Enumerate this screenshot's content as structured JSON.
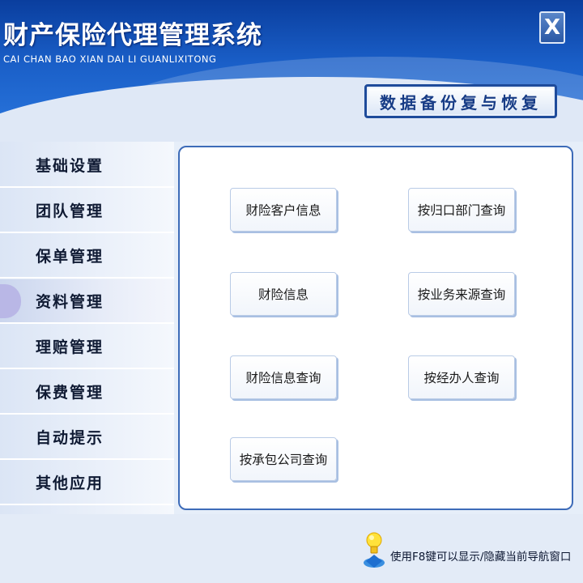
{
  "header": {
    "title": "财产保险代理管理系统",
    "subtitle": "CAI CHAN BAO XIAN DAI LI GUANLIXITONG",
    "close_label": "X",
    "backup_label": "数据备份复与恢复"
  },
  "sidebar": {
    "items": [
      {
        "label": "基础设置"
      },
      {
        "label": "团队管理"
      },
      {
        "label": "保单管理"
      },
      {
        "label": "资料管理",
        "active": true
      },
      {
        "label": "理赔管理"
      },
      {
        "label": "保费管理"
      },
      {
        "label": "自动提示"
      },
      {
        "label": "其他应用"
      }
    ]
  },
  "content": {
    "buttons": [
      {
        "label": "财险客户信息"
      },
      {
        "label": "按归口部门查询"
      },
      {
        "label": "财险信息"
      },
      {
        "label": "按业务来源查询"
      },
      {
        "label": "财险信息查询"
      },
      {
        "label": "按经办人查询"
      },
      {
        "label": "按承包公司查询"
      }
    ]
  },
  "footer": {
    "tip": "使用F8键可以显示/隐藏当前导航窗口",
    "icon": "lightbulb-icon"
  },
  "colors": {
    "header_blue": "#1a5fc8",
    "panel_border": "#3d6bb8",
    "active_item": "#b9b7e6"
  }
}
